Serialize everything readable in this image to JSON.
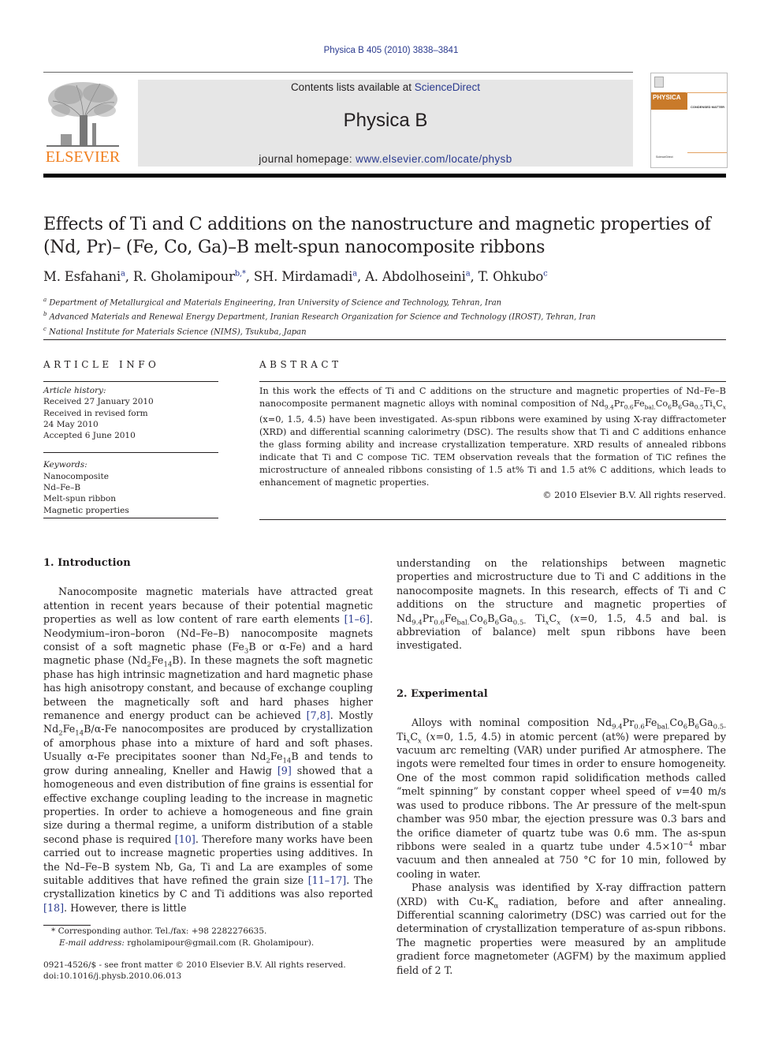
{
  "citation": "Physica B 405 (2010) 3838–3841",
  "header": {
    "publisher_logo_text": "ELSEVIER",
    "contents_prefix": "Contents lists available at ",
    "contents_link": "ScienceDirect",
    "journal_title": "Physica B",
    "homepage_prefix": "journal homepage: ",
    "homepage_link": "www.elsevier.com/locate/physb",
    "cover_label": "PHYSICA",
    "cover_subtitle": "CONDENSED MATTER",
    "cover_sd": "ScienceDirect"
  },
  "article": {
    "title_line1": "Effects of Ti and C additions on the nanostructure and magnetic properties of",
    "title_line2": "(Nd, Pr)– (Fe, Co, Ga)–B melt-spun nanocomposite ribbons",
    "authors": [
      {
        "name": "M. Esfahani",
        "aff": "a"
      },
      {
        "name": "R. Gholamipour",
        "aff": "b,*"
      },
      {
        "name": "SH. Mirdamadi",
        "aff": "a"
      },
      {
        "name": "A. Abdolhoseini",
        "aff": "a"
      },
      {
        "name": "T. Ohkubo",
        "aff": "c"
      }
    ],
    "affiliations": [
      {
        "key": "a",
        "text": "Department of Metallurgical and Materials Engineering, Iran University of Science and Technology, Tehran, Iran"
      },
      {
        "key": "b",
        "text": "Advanced Materials and Renewal Energy Department, Iranian Research Organization for Science and Technology (IROST), Tehran, Iran"
      },
      {
        "key": "c",
        "text": "National Institute for Materials Science (NIMS), Tsukuba, Japan"
      }
    ]
  },
  "article_info": {
    "heading": "ARTICLE INFO",
    "history_label": "Article history:",
    "history": [
      "Received 27 January 2010",
      "Received in revised form",
      "24 May 2010",
      "Accepted 6 June 2010"
    ],
    "keywords_label": "Keywords:",
    "keywords": [
      "Nanocomposite",
      "Nd–Fe–B",
      "Melt-spun ribbon",
      "Magnetic properties"
    ]
  },
  "abstract": {
    "heading": "ABSTRACT",
    "part1": "In this work the effects of Ti and C additions on the structure and magnetic properties of Nd–Fe–B nanocomposite permanent magnetic alloys with nominal composition of ",
    "formula": "Nd9.4Pr0.6Febal.Co6B6Ga0.5TixCx",
    "part2": " (x=0, 1.5, 4.5) have been investigated. As-spun ribbons were examined by using X-ray diffractometer (XRD) and differential scanning calorimetry (DSC). The results show that Ti and C additions enhance the glass forming ability and increase crystallization temperature. XRD results of annealed ribbons indicate that Ti and C compose TiC. TEM observation reveals that the formation of TiC refines the microstructure of annealed ribbons consisting of 1.5 at% Ti and 1.5 at% C additions, which leads to enhancement of magnetic properties.",
    "copyright": "© 2010 Elsevier B.V. All rights reserved."
  },
  "sections": {
    "intro_heading": "1.  Introduction",
    "intro_text": "Nanocomposite magnetic materials have attracted great attention in recent years because of their potential magnetic properties as well as low content of rare earth elements [1–6]. Neodymium–iron–boron (Nd–Fe–B) nanocomposite magnets consist of a soft magnetic phase (Fe3B or α-Fe) and a hard magnetic phase (Nd2Fe14B). In these magnets the soft magnetic phase has high intrinsic magnetization and hard magnetic phase has high anisotropy constant, and because of exchange coupling between the magnetically soft and hard phases higher remanence and energy product can be achieved [7,8]. Mostly Nd2Fe14B/α-Fe nanocomposites are produced by crystallization of amorphous phase into a mixture of hard and soft phases. Usually α-Fe precipitates sooner than Nd2Fe14B and tends to grow during annealing, Kneller and Hawig [9] showed that a homogeneous and even distribution of fine grains is essential for effective exchange coupling leading to the increase in magnetic properties. In order to achieve a homogeneous and fine grain size during a thermal regime, a uniform distribution of a stable second phase is required [10]. Therefore many works have been carried out to increase magnetic properties using additives. In the Nd–Fe–B system Nb, Ga, Ti and La are examples of some suitable additives that have refined the grain size [11–17]. The crystallization kinetics by C and Ti additions was also reported [18]. However, there is little understanding on the relationships between magnetic properties and microstructure due to Ti and C additions in the nanocomposite magnets. In this research, effects of Ti and C additions on the structure and magnetic properties of Nd9.4Pr0.6Febal.Co6B6Ga0.5-TixCx (x=0, 1.5, 4.5 and bal. is abbreviation of balance) melt spun ribbons have been investigated.",
    "exp_heading": "2.  Experimental",
    "exp_p1": "Alloys with nominal composition Nd9.4Pr0.6Febal.Co6B6Ga0.5-TixCx (x=0, 1.5, 4.5) in atomic percent (at%) were prepared by vacuum arc remelting (VAR) under purified Ar atmosphere. The ingots were remelted four times in order to ensure homogeneity. One of the most common rapid solidification methods called “melt spinning” by constant copper wheel speed of v=40 m/s was used to produce ribbons. The Ar pressure of the melt-spun chamber was 950 mbar, the ejection pressure was 0.3 bars and the orifice diameter of quartz tube was 0.6 mm. The as-spun ribbons were sealed in a quartz tube under 4.5×10−4 mbar vacuum and then annealed at 750 °C for 10 min, followed by cooling in water.",
    "exp_p2": "Phase analysis was identified by X-ray diffraction pattern (XRD) with Cu-Kα radiation, before and after annealing. Differential scanning calorimetry (DSC) was carried out for the determination of crystallization temperature of as-spun ribbons. The magnetic properties were measured by an amplitude gradient force magnetometer (AGFM) by the maximum applied field of 2 T."
  },
  "footnotes": {
    "corresponding": "Corresponding author. Tel./fax: +98 2282276635.",
    "email_label": "E-mail address:",
    "email": "rgholamipour@gmail.com (R. Gholamipour).",
    "front_matter": "0921-4526/$ - see front matter © 2010 Elsevier B.V. All rights reserved.",
    "doi": "doi:10.1016/j.physb.2010.06.013"
  },
  "colors": {
    "link": "#2a3a8f",
    "elsevier_orange": "#f07f1e",
    "band_gray": "#e6e6e6"
  }
}
